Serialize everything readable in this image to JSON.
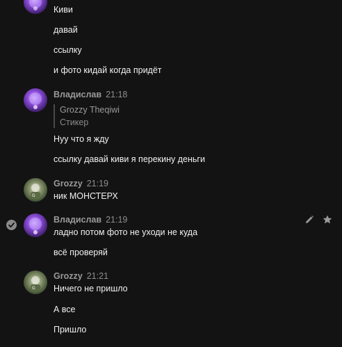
{
  "messages": [
    {
      "text": "Киви"
    },
    {
      "text": "давай"
    },
    {
      "text": "ссылку"
    },
    {
      "text": "и фото кидай когда придёт"
    }
  ],
  "groups": [
    {
      "author": "Владислав",
      "time": "21:18",
      "reply": {
        "title": "Grozzy Theqiwi",
        "subtitle": "Стикер"
      },
      "lines": [
        "Нуу что я жду",
        "ссылку давай киви я перекину деньги"
      ]
    },
    {
      "author": "Grozzy",
      "time": "21:19",
      "lines": [
        "ник МОНСТЕРХ"
      ]
    },
    {
      "author": "Владислав",
      "time": "21:19",
      "lines": [
        "ладно потом фото не уходи не куда",
        "всё проверяй"
      ]
    },
    {
      "author": "Grozzy",
      "time": "21:21",
      "lines": [
        "Ничего не пришло",
        "А все",
        "Пришло"
      ]
    }
  ],
  "icons": {
    "check": "check-circle-icon",
    "edit": "pencil-icon",
    "pin": "star-icon"
  },
  "colors": {
    "background": "#131313",
    "text": "#f1f1f1",
    "muted": "#9a9a9a"
  }
}
